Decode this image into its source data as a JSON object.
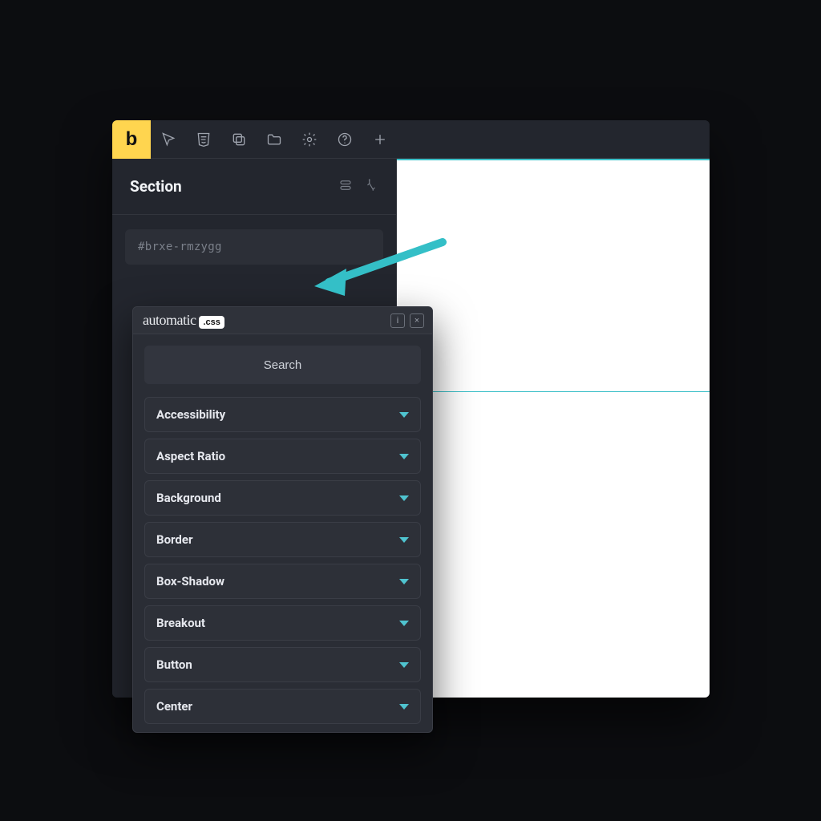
{
  "app": {
    "logo_letter": "b",
    "toolbar_icons": [
      "cursor",
      "css3",
      "copy",
      "folder",
      "settings",
      "help",
      "plus"
    ]
  },
  "element": {
    "title": "Section",
    "header_icons": [
      "layout",
      "interactions"
    ],
    "id_value": "#brxe-rmzygg"
  },
  "acss": {
    "brand_left": "automatic",
    "brand_tag": ".css",
    "head_buttons": {
      "info": "i",
      "close": "×"
    },
    "search_placeholder": "Search",
    "categories": [
      "Accessibility",
      "Aspect Ratio",
      "Background",
      "Border",
      "Box-Shadow",
      "Breakout",
      "Button",
      "Center"
    ]
  },
  "colors": {
    "accent_yellow": "#ffd54f",
    "accent_teal": "#4fc3cf",
    "arrow": "#34bfc7",
    "bg_dark": "#0c0d10",
    "panel": "#23262e"
  }
}
